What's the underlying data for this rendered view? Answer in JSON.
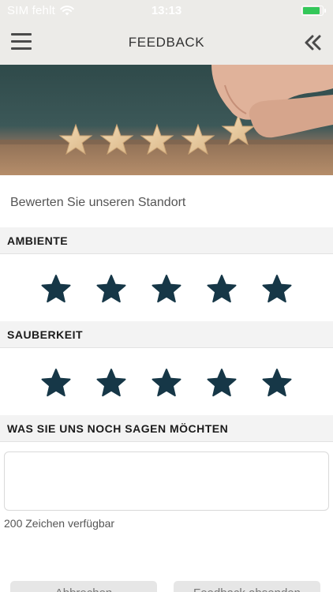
{
  "status_bar": {
    "carrier": "SIM fehlt",
    "time": "13:13",
    "battery_level": 0.9
  },
  "header": {
    "title": "FEEDBACK"
  },
  "page": {
    "subtitle": "Bewerten Sie unseren Standort"
  },
  "sections": {
    "ambiente": {
      "label": "AMBIENTE",
      "rating": 5,
      "max": 5
    },
    "sauberkeit": {
      "label": "SAUBERKEIT",
      "rating": 5,
      "max": 5
    },
    "message": {
      "label": "WAS SIE UNS NOCH SAGEN MÖCHTEN",
      "value": "",
      "chars_remaining": "200 Zeichen verfügbar"
    }
  },
  "buttons": {
    "cancel": "Abbrechen",
    "submit": "Feedback absenden"
  },
  "colors": {
    "star": "#163747",
    "header_bg": "#ecebe8",
    "battery": "#34c759"
  }
}
